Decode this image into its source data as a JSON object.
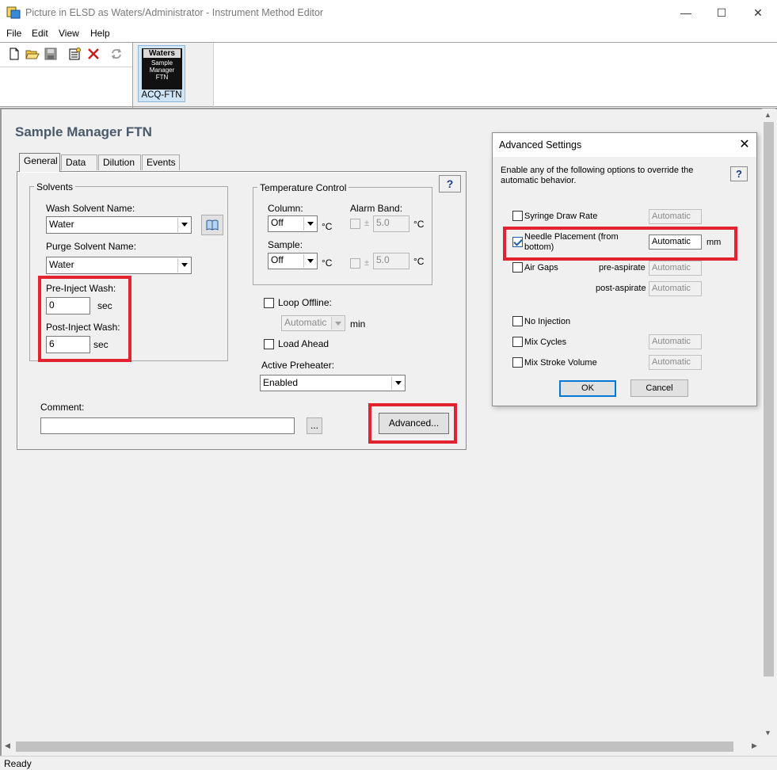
{
  "window": {
    "title": "Picture in ELSD as Waters/Administrator - Instrument Method Editor",
    "controls": {
      "minimize": "—",
      "maximize": "☐",
      "close": "✕"
    }
  },
  "menu": [
    "File",
    "Edit",
    "View",
    "Help"
  ],
  "toolbar": {
    "icons": [
      "new-document-icon",
      "open-folder-icon",
      "save-icon",
      "properties-icon",
      "delete-icon",
      "refresh-icon"
    ]
  },
  "module": {
    "brand": "Waters",
    "line1": "Sample",
    "line2": "Manager",
    "line3": "FTN",
    "label": "ACQ-FTN"
  },
  "page": {
    "heading": "Sample Manager FTN",
    "tabs": [
      "General",
      "Data",
      "Dilution",
      "Events"
    ],
    "active_tab": "General",
    "help": "?"
  },
  "solvents": {
    "group_title": "Solvents",
    "wash_label": "Wash Solvent Name:",
    "wash_value": "Water",
    "purge_label": "Purge Solvent Name:",
    "purge_value": "Water",
    "pre_inject_label": "Pre-Inject Wash:",
    "pre_inject_value": "0",
    "post_inject_label": "Post-Inject Wash:",
    "post_inject_value": "6",
    "unit": "sec"
  },
  "temperature": {
    "group_title": "Temperature Control",
    "column_label": "Column:",
    "column_value": "Off",
    "sample_label": "Sample:",
    "sample_value": "Off",
    "alarm_label": "Alarm Band:",
    "alarm_column_value": "5.0",
    "alarm_sample_value": "5.0",
    "unit": "°C",
    "plusminus": "±"
  },
  "loop": {
    "loop_offline_label": "Loop Offline:",
    "loop_offline_value": "Automatic",
    "loop_unit": "min",
    "load_ahead_label": "Load Ahead",
    "preheater_label": "Active Preheater:",
    "preheater_value": "Enabled"
  },
  "comment": {
    "label": "Comment:",
    "value": "",
    "browse": "..."
  },
  "advanced_button": "Advanced...",
  "dialog": {
    "title": "Advanced Settings",
    "close": "✕",
    "help": "?",
    "description": "Enable any of the following options to override the automatic behavior.",
    "syringe_label": "Syringe Draw Rate",
    "syringe_value": "Automatic",
    "needle_label_1": "Needle Placement (from",
    "needle_label_2": "bottom)",
    "needle_value": "Automatic",
    "needle_unit": "mm",
    "air_gaps_label": "Air Gaps",
    "pre_aspirate_label": "pre-aspirate",
    "pre_aspirate_value": "Automatic",
    "post_aspirate_label": "post-aspirate",
    "post_aspirate_value": "Automatic",
    "no_injection_label": "No Injection",
    "mix_cycles_label": "Mix Cycles",
    "mix_cycles_value": "Automatic",
    "mix_stroke_label": "Mix Stroke Volume",
    "mix_stroke_value": "Automatic",
    "ok": "OK",
    "cancel": "Cancel"
  },
  "status": "Ready",
  "colors": {
    "highlight_red": "#e3232f",
    "check_blue": "#1a5fb4",
    "heading": "#4a5a6a"
  }
}
